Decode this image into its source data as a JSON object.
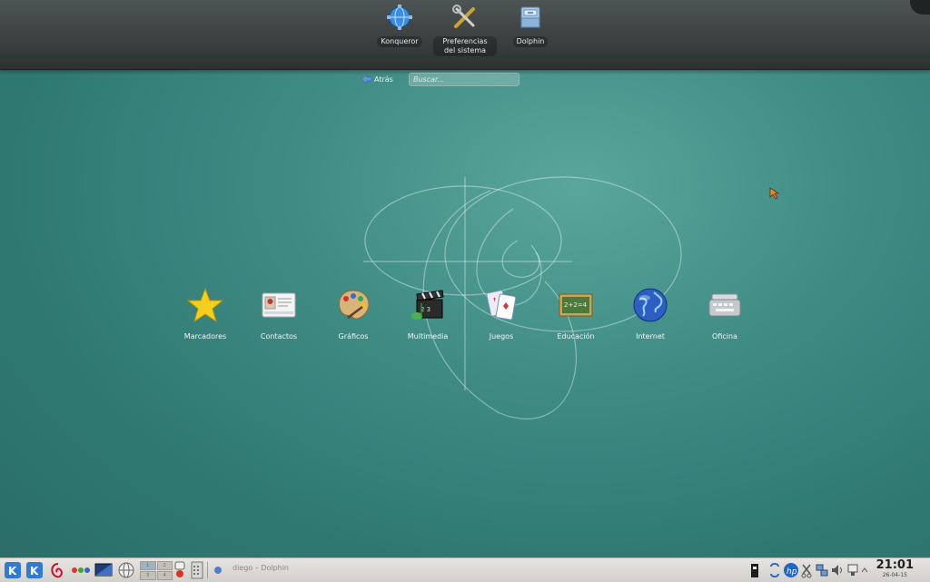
{
  "favorites": [
    {
      "label": "Konqueror",
      "icon": "konqueror-globe-icon"
    },
    {
      "label": "Preferencias del sistema",
      "icon": "system-settings-tools-icon"
    },
    {
      "label": "Dolphin",
      "icon": "dolphin-file-manager-icon"
    }
  ],
  "nav": {
    "back_label": "Atrás",
    "search_placeholder": "Buscar..."
  },
  "categories": [
    {
      "label": "Marcadores",
      "icon": "star-icon"
    },
    {
      "label": "Contactos",
      "icon": "contact-card-icon"
    },
    {
      "label": "Gráficos",
      "icon": "paint-palette-icon"
    },
    {
      "label": "Multimedia",
      "icon": "clapperboard-icon"
    },
    {
      "label": "Juegos",
      "icon": "playing-cards-icon"
    },
    {
      "label": "Educación",
      "icon": "chalkboard-icon"
    },
    {
      "label": "Internet",
      "icon": "globe-icon"
    },
    {
      "label": "Oficina",
      "icon": "typewriter-icon"
    }
  ],
  "taskbar": {
    "pager": [
      "1",
      "2",
      "3",
      "4"
    ],
    "task_label": "diego – Dolphin",
    "clock_time": "21:01",
    "clock_date": "26-04-15"
  },
  "colors": {
    "accent": "#3f8c85",
    "panel": "#3a403f",
    "taskbar": "#dddad5"
  }
}
